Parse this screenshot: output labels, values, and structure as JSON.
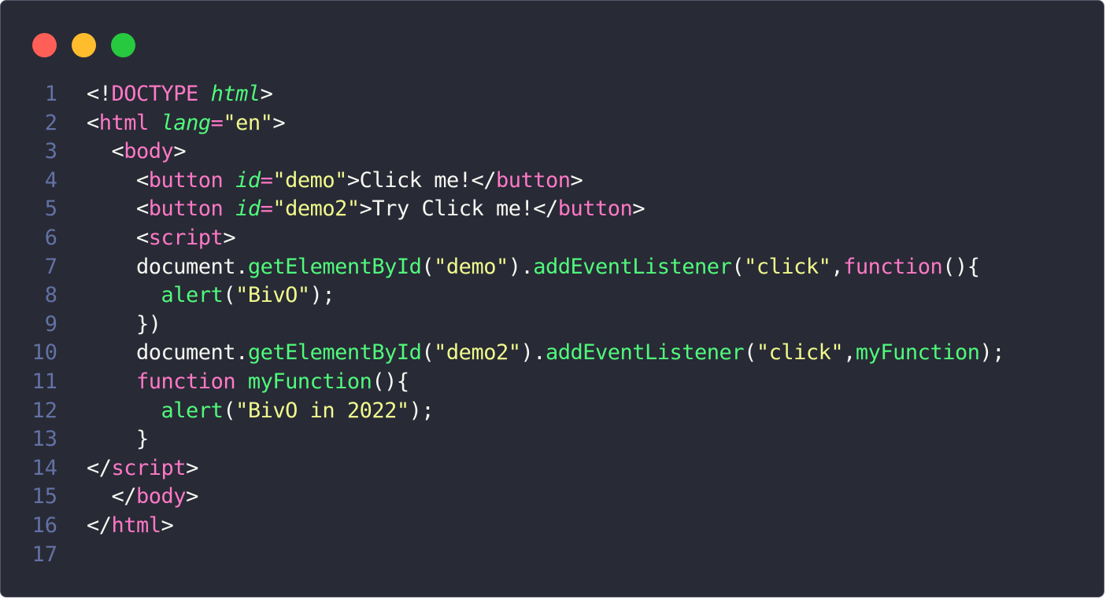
{
  "window": {
    "controls": [
      {
        "name": "close",
        "color": "#ff5f56"
      },
      {
        "name": "minimize",
        "color": "#ffbd2e"
      },
      {
        "name": "maximize",
        "color": "#27c93f"
      }
    ]
  },
  "colors": {
    "background": "#282a36",
    "line_number": "#6272a4",
    "tag": "#ff79c6",
    "attribute": "#50fa7b",
    "string": "#f1fa8c",
    "function": "#50fa7b",
    "text": "#f8f8f2"
  },
  "code": {
    "lines": [
      {
        "number": "1",
        "tokens": [
          {
            "t": "<!",
            "k": "punct"
          },
          {
            "t": "DOCTYPE",
            "k": "tag"
          },
          {
            "t": " ",
            "k": "text"
          },
          {
            "t": "html",
            "k": "attr"
          },
          {
            "t": ">",
            "k": "punct"
          }
        ]
      },
      {
        "number": "2",
        "tokens": [
          {
            "t": "<",
            "k": "punct"
          },
          {
            "t": "html",
            "k": "tag"
          },
          {
            "t": " ",
            "k": "text"
          },
          {
            "t": "lang",
            "k": "attr"
          },
          {
            "t": "=",
            "k": "op"
          },
          {
            "t": "\"en\"",
            "k": "str"
          },
          {
            "t": ">",
            "k": "punct"
          }
        ]
      },
      {
        "number": "3",
        "tokens": [
          {
            "t": "  <",
            "k": "punct"
          },
          {
            "t": "body",
            "k": "tag"
          },
          {
            "t": ">",
            "k": "punct"
          }
        ]
      },
      {
        "number": "4",
        "tokens": [
          {
            "t": "    <",
            "k": "punct"
          },
          {
            "t": "button",
            "k": "tag"
          },
          {
            "t": " ",
            "k": "text"
          },
          {
            "t": "id",
            "k": "attr"
          },
          {
            "t": "=",
            "k": "op"
          },
          {
            "t": "\"demo\"",
            "k": "str"
          },
          {
            "t": ">Click me!</",
            "k": "punct"
          },
          {
            "t": "button",
            "k": "tag"
          },
          {
            "t": ">",
            "k": "punct"
          }
        ]
      },
      {
        "number": "5",
        "tokens": [
          {
            "t": "    <",
            "k": "punct"
          },
          {
            "t": "button",
            "k": "tag"
          },
          {
            "t": " ",
            "k": "text"
          },
          {
            "t": "id",
            "k": "attr"
          },
          {
            "t": "=",
            "k": "op"
          },
          {
            "t": "\"demo2\"",
            "k": "str"
          },
          {
            "t": ">Try Click me!</",
            "k": "punct"
          },
          {
            "t": "button",
            "k": "tag"
          },
          {
            "t": ">",
            "k": "punct"
          }
        ]
      },
      {
        "number": "6",
        "tokens": [
          {
            "t": "    <",
            "k": "punct"
          },
          {
            "t": "script",
            "k": "tag"
          },
          {
            "t": ">",
            "k": "punct"
          }
        ]
      },
      {
        "number": "7",
        "tokens": [
          {
            "t": "    document.",
            "k": "text"
          },
          {
            "t": "getElementById",
            "k": "fn"
          },
          {
            "t": "(",
            "k": "punct"
          },
          {
            "t": "\"demo\"",
            "k": "str"
          },
          {
            "t": ").",
            "k": "punct"
          },
          {
            "t": "addEventListener",
            "k": "fn"
          },
          {
            "t": "(",
            "k": "punct"
          },
          {
            "t": "\"click\"",
            "k": "str"
          },
          {
            "t": ",",
            "k": "punct"
          },
          {
            "t": "function",
            "k": "kw"
          },
          {
            "t": "(){",
            "k": "punct"
          }
        ]
      },
      {
        "number": "8",
        "tokens": [
          {
            "t": "      ",
            "k": "text"
          },
          {
            "t": "alert",
            "k": "fn"
          },
          {
            "t": "(",
            "k": "punct"
          },
          {
            "t": "\"BivO\"",
            "k": "str"
          },
          {
            "t": ");",
            "k": "punct"
          }
        ]
      },
      {
        "number": "9",
        "tokens": [
          {
            "t": "    })",
            "k": "punct"
          }
        ]
      },
      {
        "number": "10",
        "tokens": [
          {
            "t": "    document.",
            "k": "text"
          },
          {
            "t": "getElementById",
            "k": "fn"
          },
          {
            "t": "(",
            "k": "punct"
          },
          {
            "t": "\"demo2\"",
            "k": "str"
          },
          {
            "t": ").",
            "k": "punct"
          },
          {
            "t": "addEventListener",
            "k": "fn"
          },
          {
            "t": "(",
            "k": "punct"
          },
          {
            "t": "\"click\"",
            "k": "str"
          },
          {
            "t": ",",
            "k": "punct"
          },
          {
            "t": "myFunction",
            "k": "fn"
          },
          {
            "t": ");",
            "k": "punct"
          }
        ]
      },
      {
        "number": "11",
        "tokens": [
          {
            "t": "    ",
            "k": "text"
          },
          {
            "t": "function",
            "k": "kw"
          },
          {
            "t": " ",
            "k": "text"
          },
          {
            "t": "myFunction",
            "k": "fn"
          },
          {
            "t": "(){",
            "k": "punct"
          }
        ]
      },
      {
        "number": "12",
        "tokens": [
          {
            "t": "      ",
            "k": "text"
          },
          {
            "t": "alert",
            "k": "fn"
          },
          {
            "t": "(",
            "k": "punct"
          },
          {
            "t": "\"BivO in 2022\"",
            "k": "str"
          },
          {
            "t": ");",
            "k": "punct"
          }
        ]
      },
      {
        "number": "13",
        "tokens": [
          {
            "t": "    }",
            "k": "punct"
          }
        ]
      },
      {
        "number": "14",
        "tokens": [
          {
            "t": "</",
            "k": "punct"
          },
          {
            "t": "script",
            "k": "tag"
          },
          {
            "t": ">",
            "k": "punct"
          }
        ]
      },
      {
        "number": "15",
        "tokens": [
          {
            "t": "  </",
            "k": "punct"
          },
          {
            "t": "body",
            "k": "tag"
          },
          {
            "t": ">",
            "k": "punct"
          }
        ]
      },
      {
        "number": "16",
        "tokens": [
          {
            "t": "</",
            "k": "punct"
          },
          {
            "t": "html",
            "k": "tag"
          },
          {
            "t": ">",
            "k": "punct"
          }
        ]
      },
      {
        "number": "17",
        "tokens": []
      }
    ]
  }
}
